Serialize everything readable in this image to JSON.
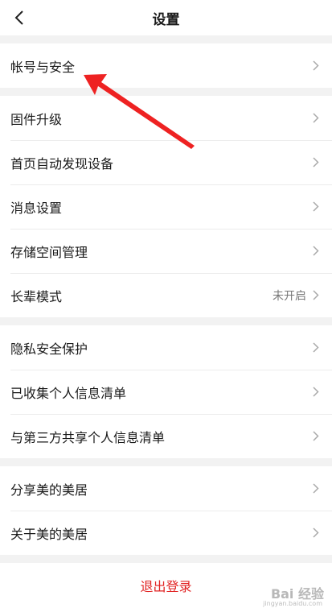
{
  "header": {
    "title": "设置",
    "back_icon": "chevron-left-icon"
  },
  "groups": [
    [
      {
        "label": "帐号与安全"
      }
    ],
    [
      {
        "label": "固件升级"
      },
      {
        "label": "首页自动发现设备"
      },
      {
        "label": "消息设置"
      },
      {
        "label": "存储空间管理"
      },
      {
        "label": "长辈模式",
        "value": "未开启"
      }
    ],
    [
      {
        "label": "隐私安全保护"
      },
      {
        "label": "已收集个人信息清单"
      },
      {
        "label": "与第三方共享个人信息清单"
      }
    ],
    [
      {
        "label": "分享美的美居"
      },
      {
        "label": "关于美的美居"
      }
    ]
  ],
  "logout_label": "退出登录",
  "colors": {
    "logout": "#e12424",
    "annotation_arrow": "#ee2222"
  },
  "watermark": {
    "brand": "Bai 经验",
    "url": "jingyan.baidu.com"
  }
}
